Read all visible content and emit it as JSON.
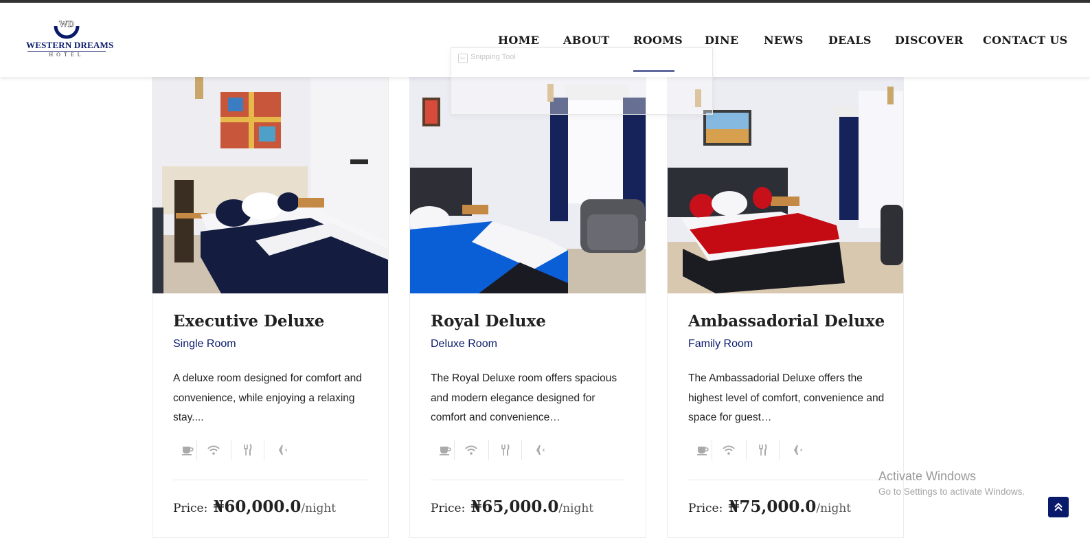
{
  "brand": {
    "monogram": "WD",
    "name": "WESTERN DREAMS",
    "subtitle": "HOTEL",
    "primary_color": "#0a1a6b"
  },
  "nav": {
    "items": [
      {
        "label": "HOME"
      },
      {
        "label": "ABOUT"
      },
      {
        "label": "ROOMS",
        "active": true
      },
      {
        "label": "DINE"
      },
      {
        "label": "NEWS"
      },
      {
        "label": "DEALS"
      },
      {
        "label": "DISCOVER"
      },
      {
        "label": "CONTACT US"
      }
    ]
  },
  "overlay": {
    "snipping_tool_title": "Snipping Tool"
  },
  "rooms": [
    {
      "title": "Executive Deluxe",
      "type": "Single Room",
      "description": "A deluxe room designed for comfort and convenience, while enjoying a relaxing stay....",
      "price_label": "Price:",
      "price": "₦60,000.0",
      "price_unit": "/night",
      "image": "bedroom-photo",
      "accent_color": "#14204a"
    },
    {
      "title": "Royal Deluxe",
      "type": "Deluxe Room",
      "description": "The Royal Deluxe room offers spacious and modern elegance designed for comfort and convenience…",
      "price_label": "Price:",
      "price": "₦65,000.0",
      "price_unit": "/night",
      "image": "bedroom-photo",
      "accent_color": "#0b5fd6"
    },
    {
      "title": "Ambassadorial Deluxe",
      "type": "Family Room",
      "description": "The Ambassadorial Deluxe offers the highest level of comfort, convenience and space for guest…",
      "price_label": "Price:",
      "price": "₦75,000.0",
      "price_unit": "/night",
      "image": "bedroom-photo",
      "accent_color": "#c40b14"
    }
  ],
  "amenities": [
    {
      "icon": "coffee-cup-icon"
    },
    {
      "icon": "wifi-icon"
    },
    {
      "icon": "fork-knife-icon"
    },
    {
      "icon": "airplane-icon"
    }
  ],
  "watermark": {
    "title": "Activate Windows",
    "subtitle": "Go to Settings to activate Windows."
  },
  "scroll_top": {
    "icon": "double-chevron-up-icon"
  }
}
